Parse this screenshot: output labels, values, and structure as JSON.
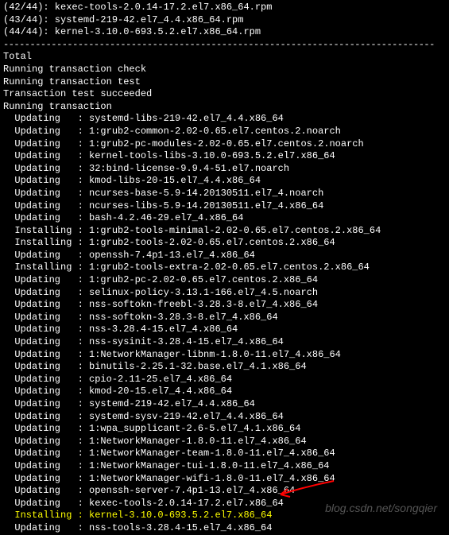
{
  "downloads": [
    "(42/44): kexec-tools-2.0.14-17.2.el7.x86_64.rpm",
    "(43/44): systemd-219-42.el7_4.4.x86_64.rpm",
    "(44/44): kernel-3.10.0-693.5.2.el7.x86_64.rpm"
  ],
  "separator": "---------------------------------------------------------------------------------",
  "summary": [
    "Total",
    "Running transaction check",
    "Running transaction test",
    "Transaction test succeeded",
    "Running transaction"
  ],
  "operations": [
    {
      "action": "Updating  ",
      "pkg": "systemd-libs-219-42.el7_4.4.x86_64"
    },
    {
      "action": "Updating  ",
      "pkg": "1:grub2-common-2.02-0.65.el7.centos.2.noarch"
    },
    {
      "action": "Updating  ",
      "pkg": "1:grub2-pc-modules-2.02-0.65.el7.centos.2.noarch"
    },
    {
      "action": "Updating  ",
      "pkg": "kernel-tools-libs-3.10.0-693.5.2.el7.x86_64"
    },
    {
      "action": "Updating  ",
      "pkg": "32:bind-license-9.9.4-51.el7.noarch"
    },
    {
      "action": "Updating  ",
      "pkg": "kmod-libs-20-15.el7_4.4.x86_64"
    },
    {
      "action": "Updating  ",
      "pkg": "ncurses-base-5.9-14.20130511.el7_4.noarch"
    },
    {
      "action": "Updating  ",
      "pkg": "ncurses-libs-5.9-14.20130511.el7_4.x86_64"
    },
    {
      "action": "Updating  ",
      "pkg": "bash-4.2.46-29.el7_4.x86_64"
    },
    {
      "action": "Installing",
      "pkg": "1:grub2-tools-minimal-2.02-0.65.el7.centos.2.x86_64"
    },
    {
      "action": "Installing",
      "pkg": "1:grub2-tools-2.02-0.65.el7.centos.2.x86_64"
    },
    {
      "action": "Updating  ",
      "pkg": "openssh-7.4p1-13.el7_4.x86_64"
    },
    {
      "action": "Installing",
      "pkg": "1:grub2-tools-extra-2.02-0.65.el7.centos.2.x86_64"
    },
    {
      "action": "Updating  ",
      "pkg": "1:grub2-pc-2.02-0.65.el7.centos.2.x86_64"
    },
    {
      "action": "Updating  ",
      "pkg": "selinux-policy-3.13.1-166.el7_4.5.noarch"
    },
    {
      "action": "Updating  ",
      "pkg": "nss-softokn-freebl-3.28.3-8.el7_4.x86_64"
    },
    {
      "action": "Updating  ",
      "pkg": "nss-softokn-3.28.3-8.el7_4.x86_64"
    },
    {
      "action": "Updating  ",
      "pkg": "nss-3.28.4-15.el7_4.x86_64"
    },
    {
      "action": "Updating  ",
      "pkg": "nss-sysinit-3.28.4-15.el7_4.x86_64"
    },
    {
      "action": "Updating  ",
      "pkg": "1:NetworkManager-libnm-1.8.0-11.el7_4.x86_64"
    },
    {
      "action": "Updating  ",
      "pkg": "binutils-2.25.1-32.base.el7_4.1.x86_64"
    },
    {
      "action": "Updating  ",
      "pkg": "cpio-2.11-25.el7_4.x86_64"
    },
    {
      "action": "Updating  ",
      "pkg": "kmod-20-15.el7_4.4.x86_64"
    },
    {
      "action": "Updating  ",
      "pkg": "systemd-219-42.el7_4.4.x86_64"
    },
    {
      "action": "Updating  ",
      "pkg": "systemd-sysv-219-42.el7_4.4.x86_64"
    },
    {
      "action": "Updating  ",
      "pkg": "1:wpa_supplicant-2.6-5.el7_4.1.x86_64"
    },
    {
      "action": "Updating  ",
      "pkg": "1:NetworkManager-1.8.0-11.el7_4.x86_64"
    },
    {
      "action": "Updating  ",
      "pkg": "1:NetworkManager-team-1.8.0-11.el7_4.x86_64"
    },
    {
      "action": "Updating  ",
      "pkg": "1:NetworkManager-tui-1.8.0-11.el7_4.x86_64"
    },
    {
      "action": "Updating  ",
      "pkg": "1:NetworkManager-wifi-1.8.0-11.el7_4.x86_64"
    },
    {
      "action": "Updating  ",
      "pkg": "openssh-server-7.4p1-13.el7_4.x86_64"
    },
    {
      "action": "Updating  ",
      "pkg": "kexec-tools-2.0.14-17.2.el7.x86_64"
    },
    {
      "action": "Installing",
      "pkg": "kernel-3.10.0-693.5.2.el7.x86_64",
      "highlight": true
    },
    {
      "action": "Updating  ",
      "pkg": "nss-tools-3.28.4-15.el7_4.x86_64"
    }
  ],
  "watermark": "blog.csdn.net/songqier"
}
